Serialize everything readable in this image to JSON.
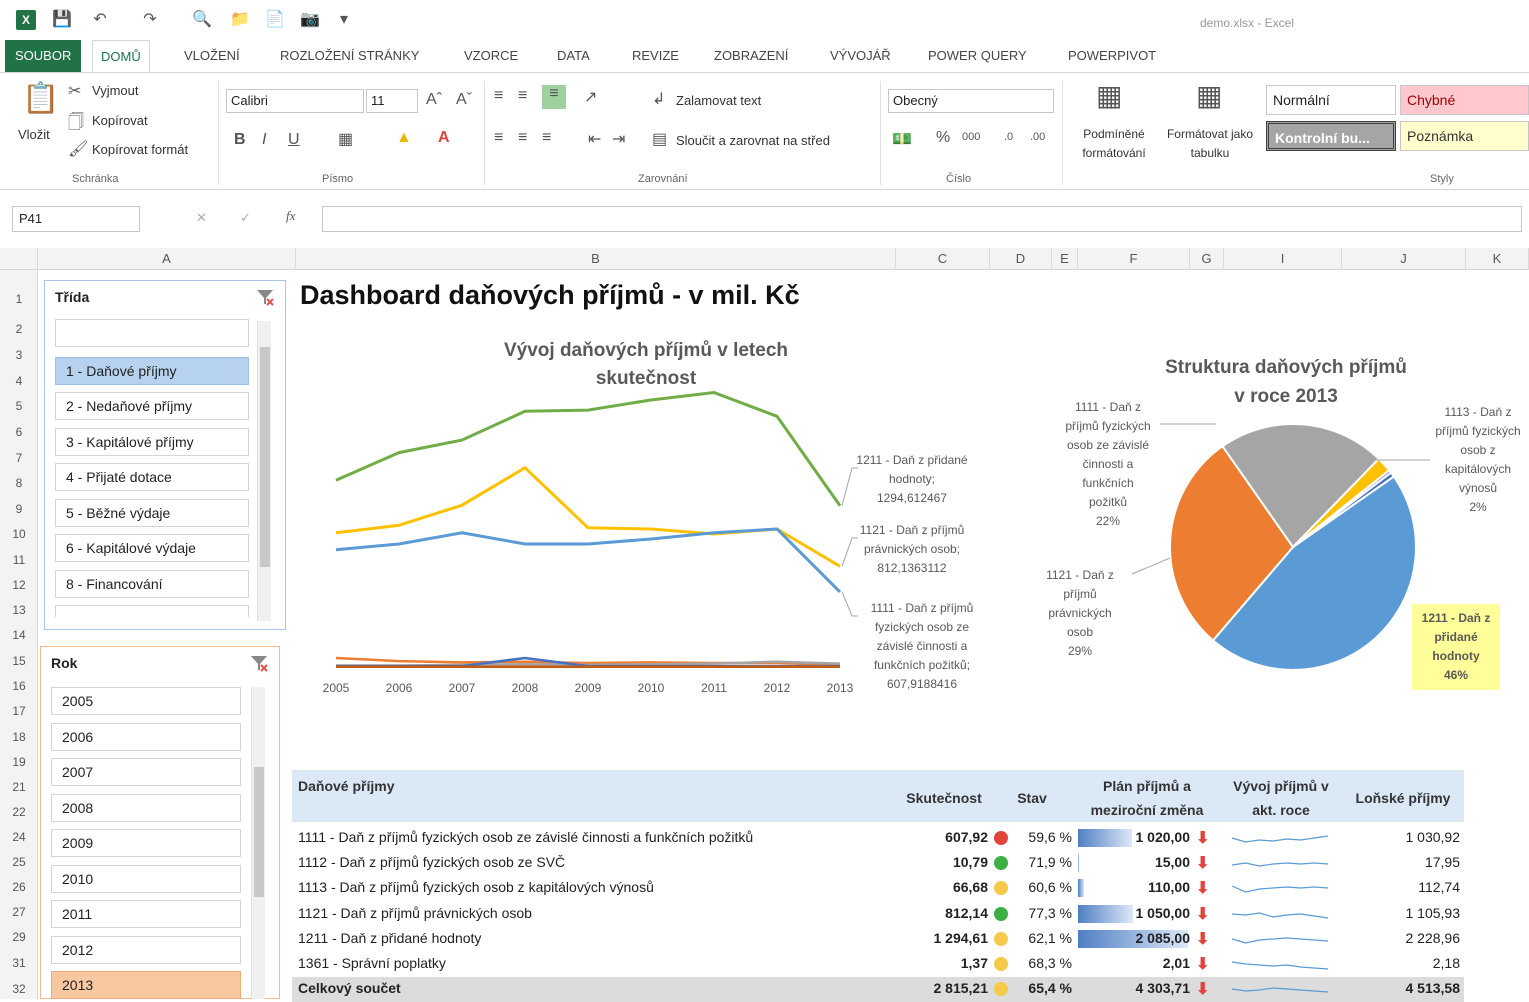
{
  "window": {
    "app": "X",
    "doc_title": "demo.xlsx - Excel"
  },
  "menu": {
    "tabs": [
      "SOUBOR",
      "DOMŮ",
      "VLOŽENÍ",
      "ROZLOŽENÍ STRÁNKY",
      "VZORCE",
      "DATA",
      "REVIZE",
      "ZOBRAZENÍ",
      "VÝVOJÁŘ",
      "POWER QUERY",
      "POWERPIVOT"
    ]
  },
  "ribbon": {
    "clipboard": {
      "paste": "Vložit",
      "cut": "Vyjmout",
      "copy": "Kopírovat",
      "format_painter": "Kopírovat formát",
      "group": "Schránka"
    },
    "font": {
      "name": "Calibri",
      "size": "11",
      "group": "Písmo"
    },
    "alignment": {
      "wrap": "Zalamovat text",
      "merge": "Sloučit a zarovnat na střed",
      "group": "Zarovnání"
    },
    "number": {
      "format": "Obecný",
      "group": "Číslo"
    },
    "styles": {
      "conditional": "Podmíněné formátování",
      "table": "Formátovat jako tabulku",
      "normal": "Normální",
      "bad": "Chybné",
      "check": "Kontrolní bu...",
      "note": "Poznámka",
      "group": "Styly"
    }
  },
  "formula": {
    "namebox": "P41",
    "fx": "fx",
    "value": ""
  },
  "columns": [
    "A",
    "B",
    "C",
    "D",
    "E",
    "F",
    "G",
    "I",
    "J",
    "K"
  ],
  "rows": [
    "1",
    "2",
    "3",
    "4",
    "5",
    "6",
    "7",
    "8",
    "9",
    "10",
    "11",
    "12",
    "13",
    "14",
    "15",
    "16",
    "17",
    "18",
    "19",
    "21",
    "22",
    "24",
    "25",
    "26",
    "27",
    "29",
    "31",
    "32"
  ],
  "slicer_trida": {
    "title": "Třída",
    "items": [
      "1 - Daňové příjmy",
      "2 - Nedaňové příjmy",
      "3 - Kapitálové příjmy",
      "4 - Přijaté dotace",
      "5 - Běžné výdaje",
      "6 - Kapitálové výdaje",
      "8 - Financování"
    ]
  },
  "slicer_rok": {
    "title": "Rok",
    "items": [
      "2005",
      "2006",
      "2007",
      "2008",
      "2009",
      "2010",
      "2011",
      "2012",
      "2013"
    ]
  },
  "dashboard_title": "Dashboard daňových příjmů - v mil. Kč",
  "chart_data": [
    {
      "type": "line",
      "title": "Vývoj daňových příjmů v letech skutečnost",
      "x": [
        "2005",
        "2006",
        "2007",
        "2008",
        "2009",
        "2010",
        "2011",
        "2012",
        "2013"
      ],
      "ylim": [
        0,
        2300
      ],
      "series": [
        {
          "color": "#70ad47",
          "values": [
            1500,
            1720,
            1820,
            2050,
            2060,
            2140,
            2200,
            2010,
            1295
          ]
        },
        {
          "color": "#ffc000",
          "values": [
            1080,
            1140,
            1300,
            1600,
            1120,
            1110,
            1070,
            1110,
            812
          ]
        },
        {
          "color": "#5b9bd5",
          "values": [
            945,
            990,
            1080,
            990,
            990,
            1030,
            1080,
            1110,
            608
          ]
        },
        {
          "color": "#ed7d31",
          "values": [
            80,
            55,
            45,
            50,
            40,
            45,
            40,
            40,
            25
          ]
        },
        {
          "color": "#a5a5a5",
          "values": [
            20,
            20,
            25,
            30,
            25,
            30,
            35,
            50,
            35
          ]
        },
        {
          "color": "#4472c4",
          "values": [
            15,
            15,
            15,
            80,
            15,
            15,
            15,
            15,
            15
          ]
        },
        {
          "color": "#c55a11",
          "values": [
            10,
            10,
            10,
            10,
            10,
            10,
            10,
            10,
            10
          ]
        }
      ],
      "labels": [
        {
          "lines": [
            "1211 - Daň z přidané",
            "hodnoty;",
            "1294,612467"
          ]
        },
        {
          "lines": [
            "1121 - Daň z příjmů",
            "právnických osob;",
            "812,1363112"
          ]
        },
        {
          "lines": [
            "1111 - Daň z příjmů",
            "fyzických osob ze",
            "závislé činnosti a",
            "funkčních požitků;",
            "607,9188416"
          ]
        }
      ]
    },
    {
      "type": "pie",
      "title": [
        "Struktura daňových příjmů",
        "v roce 2013"
      ],
      "slices": [
        {
          "label": "1211 - Daň z přidané hodnoty",
          "value": 46,
          "color": "#5b9bd5"
        },
        {
          "label": "1121 - Daň z příjmů právnických osob",
          "value": 29,
          "color": "#ed7d31"
        },
        {
          "label": "1111 - Daň z příjmů fyzických osob ze závislé činnosti a funkčních požitků",
          "value": 22,
          "color": "#a5a5a5"
        },
        {
          "label": "1113 - Daň z příjmů fyzických osob z kapitálových výnosů",
          "value": 2,
          "color": "#ffc000"
        },
        {
          "label": "other",
          "value": 0.4,
          "color": "#8e7cc3"
        },
        {
          "label": "other2",
          "value": 0.6,
          "color": "#4472c4"
        }
      ],
      "callouts": [
        {
          "lines": [
            "1111 - Daň z",
            "příjmů fyzických",
            "osob ze závislé",
            "činnosti a",
            "funkčních",
            "požitků",
            "22%"
          ]
        },
        {
          "lines": [
            "1113 - Daň z",
            "příjmů fyzických",
            "osob z",
            "kapitálových",
            "výnosů",
            "2%"
          ]
        },
        {
          "lines": [
            "1121 - Daň z",
            "příjmů",
            "právnických",
            "osob",
            "29%"
          ]
        },
        {
          "lines": [
            "1211 - Daň z",
            "přidané",
            "hodnoty",
            "46%"
          ]
        }
      ]
    }
  ],
  "table": {
    "headers": {
      "name": "Daňové příjmy",
      "actual": "Skutečnost",
      "state": "Stav",
      "plan": [
        "Plán příjmů a",
        "meziroční změna"
      ],
      "trend": [
        "Vývoj příjmů v",
        "akt. roce"
      ],
      "last": "Loňské příjmy"
    },
    "rows": [
      {
        "name": "1111 - Daň z příjmů fyzických osob ze závislé činnosti a funkčních požitků",
        "actual": "607,92",
        "status": "red",
        "pct": "59,6 %",
        "plan": "1 020,00",
        "plan_fill": 0.49,
        "last": "1 030,92"
      },
      {
        "name": "1112 - Daň z příjmů fyzických osob ze SVČ",
        "actual": "10,79",
        "status": "green",
        "pct": "71,9 %",
        "plan": "15,00",
        "plan_fill": 0.01,
        "last": "17,95"
      },
      {
        "name": "1113 - Daň z příjmů fyzických osob z kapitálových výnosů",
        "actual": "66,68",
        "status": "yellow",
        "pct": "60,6 %",
        "plan": "110,00",
        "plan_fill": 0.05,
        "last": "112,74"
      },
      {
        "name": "1121 - Daň z příjmů právnických osob",
        "actual": "812,14",
        "status": "green",
        "pct": "77,3 %",
        "plan": "1 050,00",
        "plan_fill": 0.5,
        "last": "1 105,93"
      },
      {
        "name": "1211 - Daň z přidané hodnoty",
        "actual": "1 294,61",
        "status": "yellow",
        "pct": "62,1 %",
        "plan": "2 085,00",
        "plan_fill": 1.0,
        "last": "2 228,96"
      },
      {
        "name": "1361 - Správní poplatky",
        "actual": "1,37",
        "status": "yellow",
        "pct": "68,3 %",
        "plan": "2,01",
        "plan_fill": 0.0,
        "last": "2,18"
      }
    ],
    "total": {
      "name": "Celkový součet",
      "actual": "2 815,21",
      "status": "yellow",
      "pct": "65,4 %",
      "plan": "4 303,71",
      "last": "4 513,58"
    }
  },
  "colors": {
    "excel_green": "#217346",
    "header_blue": "#dbe9f7",
    "red": "#e0443a",
    "green": "#3cb043",
    "yellow": "#f7c948"
  }
}
